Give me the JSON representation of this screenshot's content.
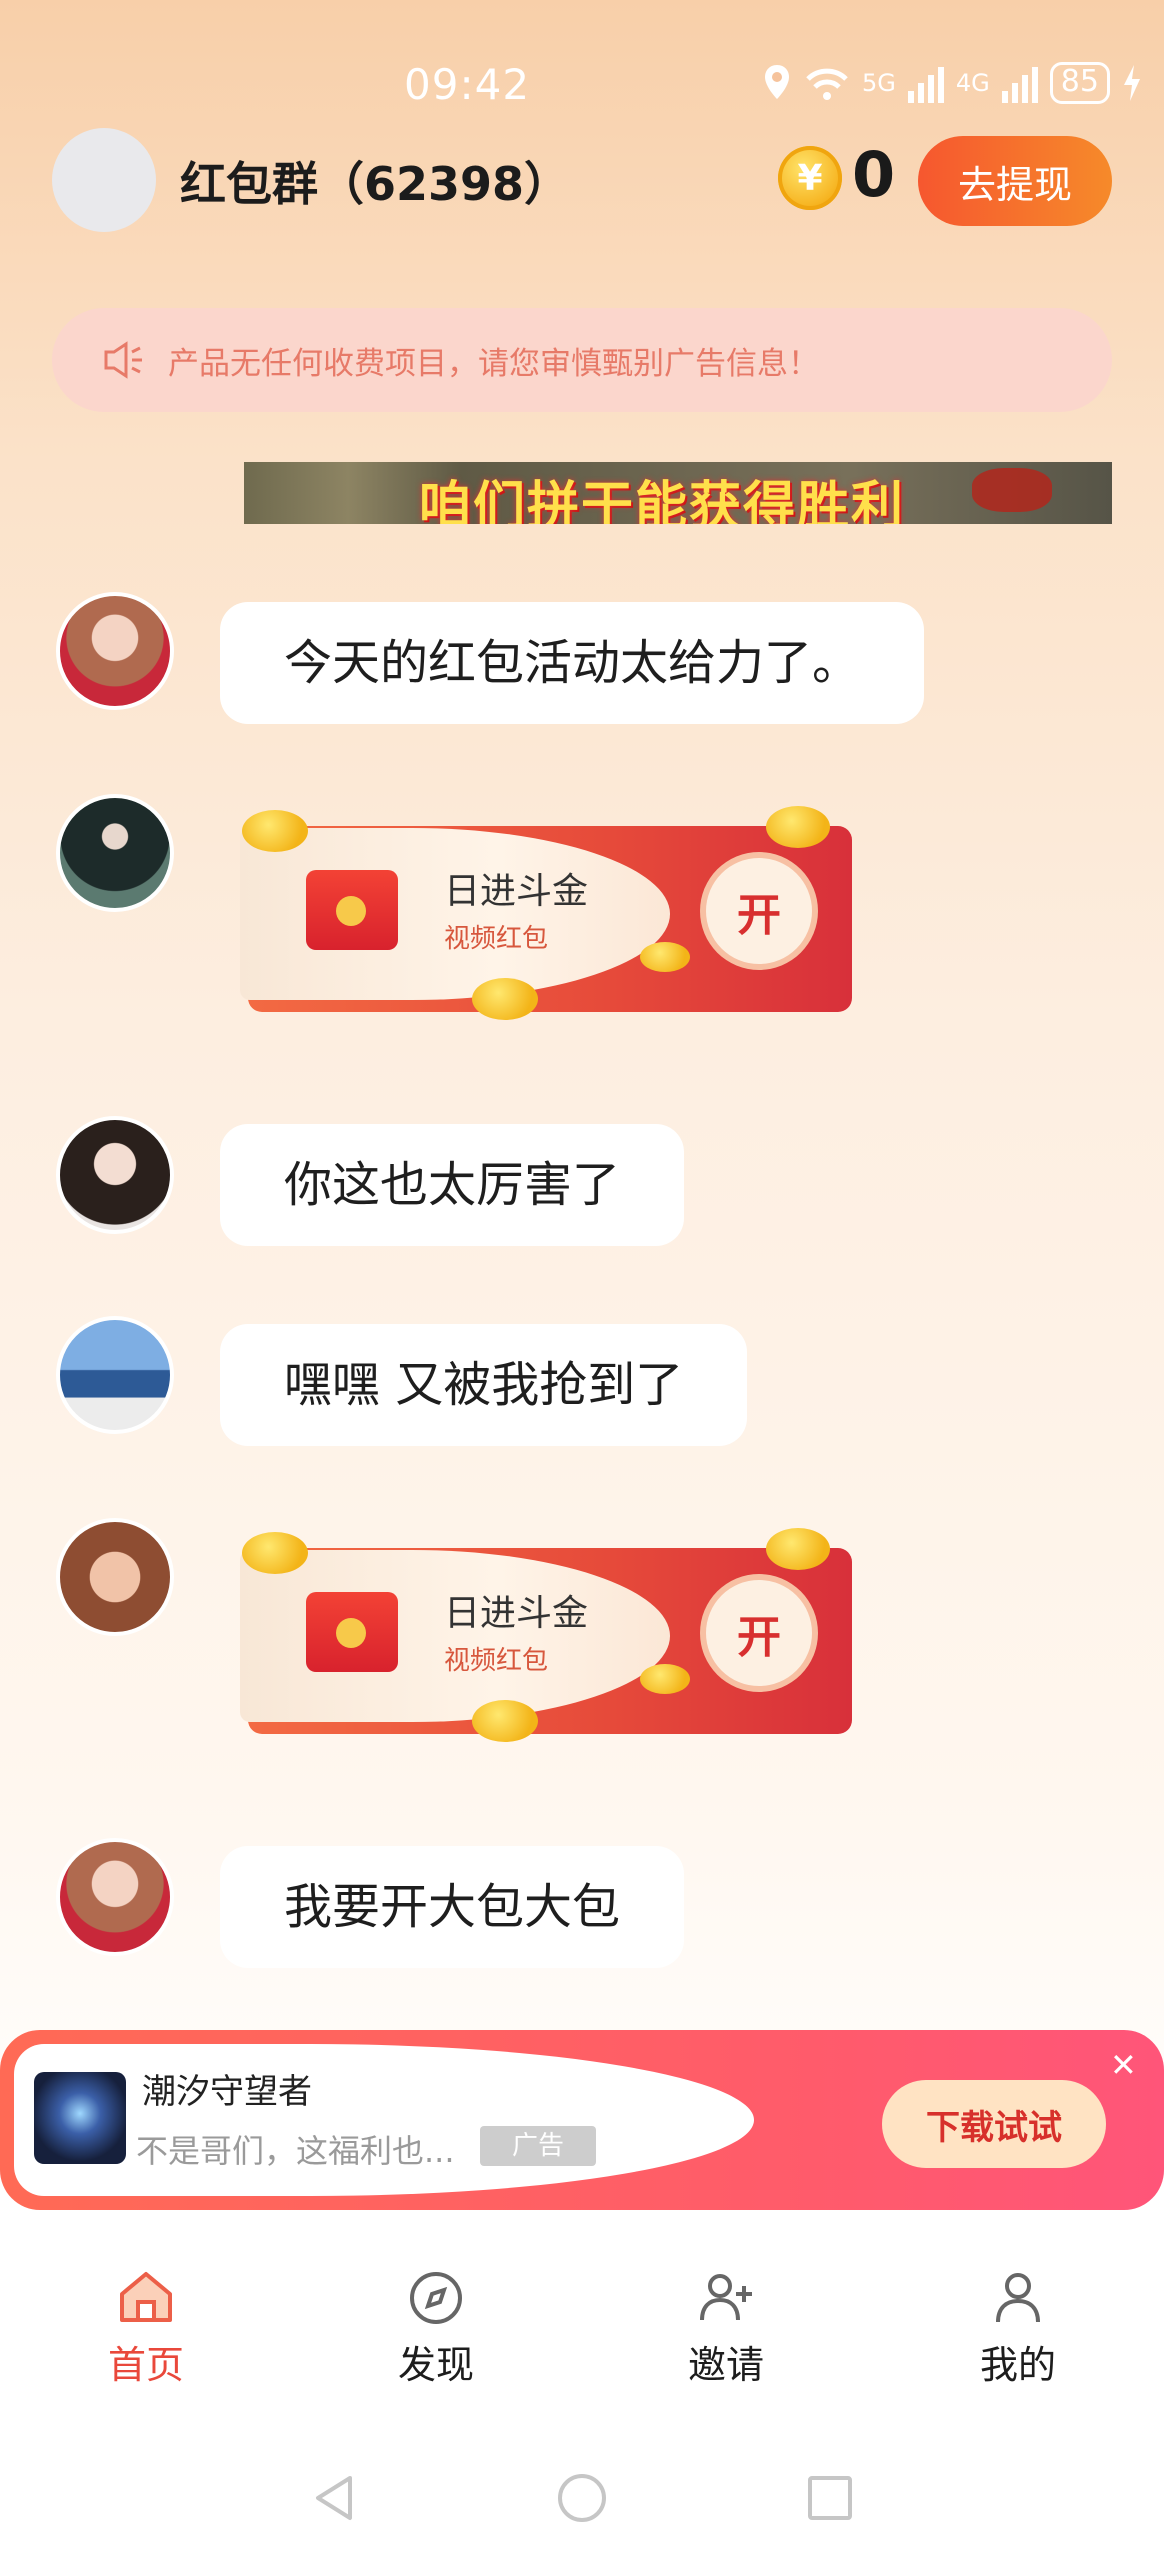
{
  "status_bar": {
    "time": "09:42",
    "network1": "5G",
    "network2": "4G",
    "battery": "85"
  },
  "header": {
    "title": "红包群（62398）",
    "coin_symbol": "¥",
    "coin_count": "0",
    "withdraw_label": "去提现"
  },
  "notice": {
    "text": "产品无任何收费项目，请您审慎甄别广告信息！"
  },
  "banner": {
    "text": "咱们拼干能获得胜利"
  },
  "messages": [
    {
      "type": "text",
      "text": "今天的红包活动太给力了。"
    },
    {
      "type": "packet",
      "title": "日进斗金",
      "subtitle": "视频红包",
      "open_label": "开"
    },
    {
      "type": "text",
      "text": "你这也太厉害了"
    },
    {
      "type": "text",
      "text": "嘿嘿 又被我抢到了"
    },
    {
      "type": "packet",
      "title": "日进斗金",
      "subtitle": "视频红包",
      "open_label": "开"
    },
    {
      "type": "text",
      "text": "我要开大包大包"
    }
  ],
  "ad": {
    "app_name": "潮汐守望者",
    "description": "不是哥们，这福利也...",
    "ad_tag": "广告",
    "download_label": "下载试试",
    "close": "✕"
  },
  "tabs": [
    {
      "label": "首页",
      "icon": "home-icon",
      "active": true
    },
    {
      "label": "发现",
      "icon": "compass-icon",
      "active": false
    },
    {
      "label": "邀请",
      "icon": "add-user-icon",
      "active": false
    },
    {
      "label": "我的",
      "icon": "user-icon",
      "active": false
    }
  ],
  "colors": {
    "accent": "#e9483b",
    "withdraw_start": "#f6572f",
    "withdraw_end": "#f68a2a"
  }
}
